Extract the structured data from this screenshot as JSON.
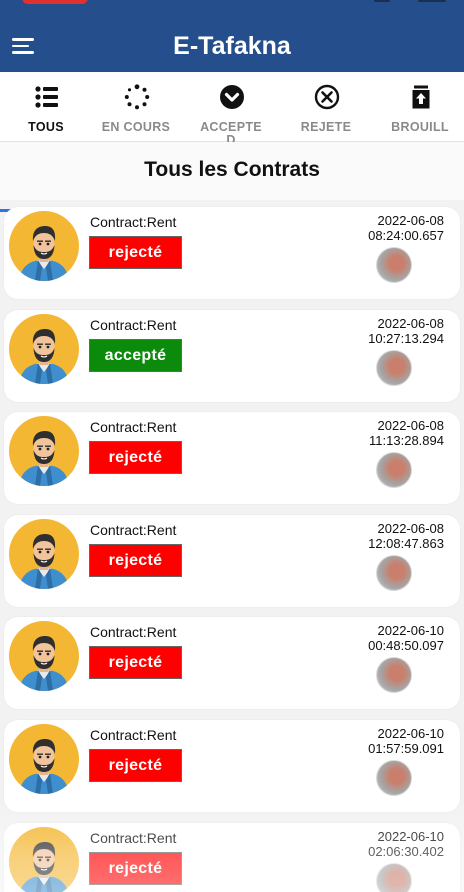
{
  "app": {
    "title": "E-Tafakna"
  },
  "tabs": [
    {
      "label": "TOUS",
      "icon": "list-icon",
      "active": true
    },
    {
      "label": "EN COURS",
      "icon": "spinner-icon",
      "active": false
    },
    {
      "label": "ACCEPTED",
      "icon": "chevron-down-circle-icon",
      "active": false
    },
    {
      "label": "REJETE",
      "icon": "close-circle-icon",
      "active": false
    },
    {
      "label": "BROUILL",
      "icon": "draft-upload-icon",
      "active": false
    }
  ],
  "page": {
    "title": "Tous les Contrats"
  },
  "contracts": [
    {
      "type": "Contract:Rent",
      "status": "rejecté",
      "date": "2022-06-08",
      "time": "08:24:00.657"
    },
    {
      "type": "Contract:Rent",
      "status": "accepté",
      "date": "2022-06-08",
      "time": "10:27:13.294"
    },
    {
      "type": "Contract:Rent",
      "status": "rejecté",
      "date": "2022-06-08",
      "time": "11:13:28.894"
    },
    {
      "type": "Contract:Rent",
      "status": "rejecté",
      "date": "2022-06-08",
      "time": "12:08:47.863"
    },
    {
      "type": "Contract:Rent",
      "status": "rejecté",
      "date": "2022-06-10",
      "time": "00:48:50.097"
    },
    {
      "type": "Contract:Rent",
      "status": "rejecté",
      "date": "2022-06-10",
      "time": "01:57:59.091"
    },
    {
      "type": "Contract:Rent",
      "status": "rejecté",
      "date": "2022-06-10",
      "time": "02:06:30.402"
    }
  ],
  "colors": {
    "header": "#244f8c",
    "rejected": "#ff0000",
    "accepted": "#0c8a0c",
    "avatar_bg": "#f4b733",
    "tab_active": "#2f72e0"
  }
}
